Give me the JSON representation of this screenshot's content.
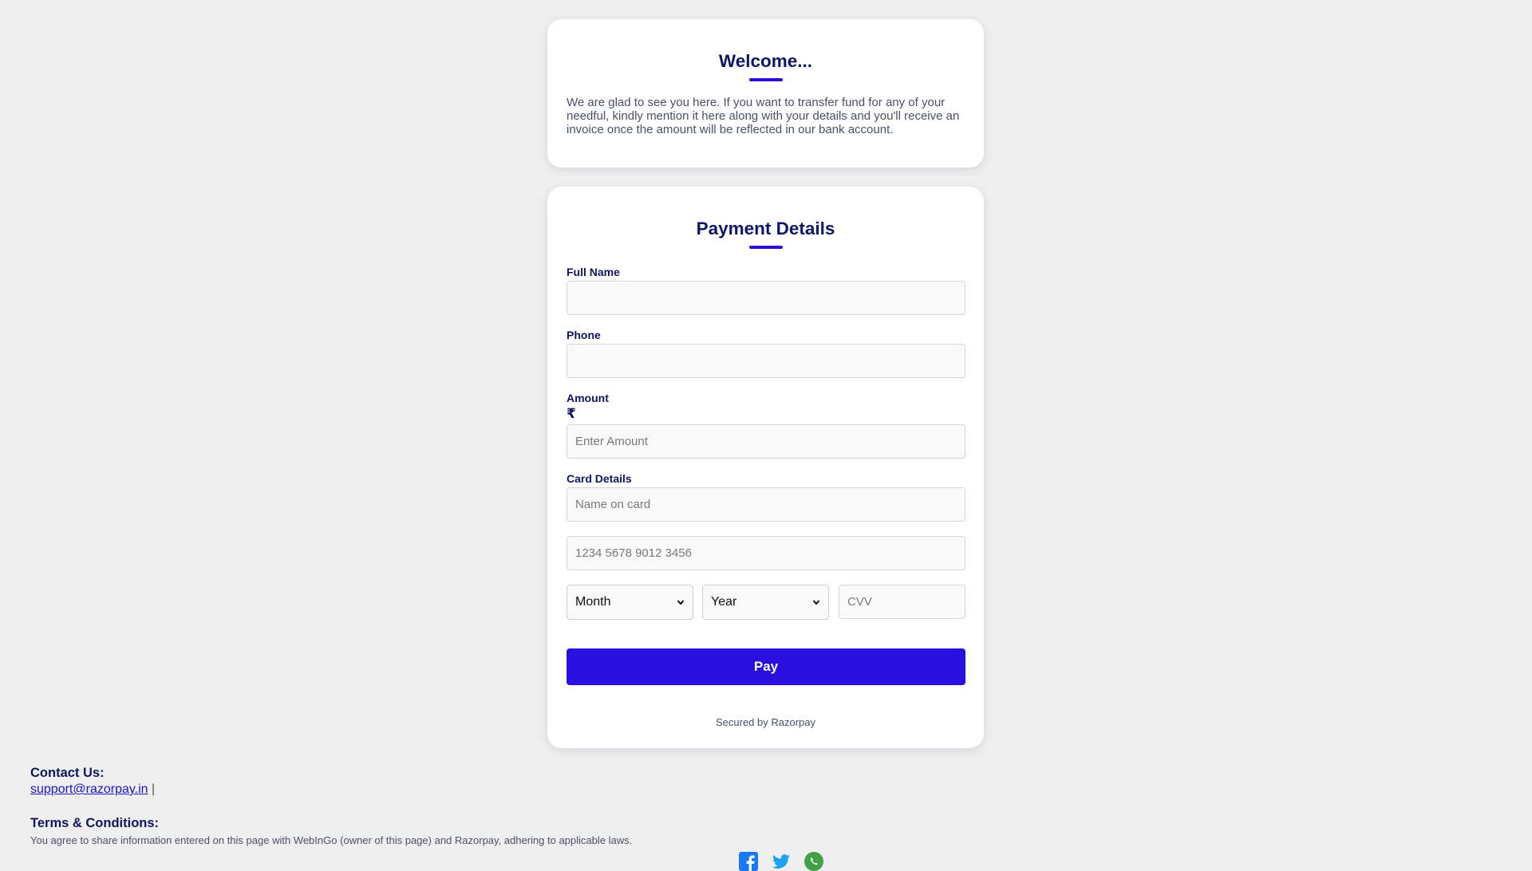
{
  "welcome": {
    "title": "Welcome...",
    "text": "We are glad to see you here. If you want to transfer fund for any of your needful, kindly mention it here along with your details and you'll receive an invoice once the amount will be reflected in our bank account."
  },
  "payment": {
    "title": "Payment Details",
    "full_name_label": "Full Name",
    "full_name_value": "",
    "phone_label": "Phone",
    "phone_value": "",
    "amount_label": "Amount",
    "currency_symbol": "₹",
    "amount_placeholder": "Enter Amount",
    "card_details_label": "Card Details",
    "name_on_card_placeholder": "Name on card",
    "card_number_placeholder": "1234 5678 9012 3456",
    "month_selected": "Month",
    "year_selected": "Year",
    "cvv_placeholder": "CVV",
    "pay_label": "Pay",
    "secured_text": "Secured by Razorpay"
  },
  "footer": {
    "contact_heading": "Contact Us:",
    "contact_email": "support@razorpay.in",
    "separator": "|",
    "terms_heading": "Terms & Conditions:",
    "terms_text": "You agree to share information entered on this page with WebInGo (owner of this page) and Razorpay, adhering to applicable laws."
  },
  "social_icons": [
    "facebook-icon",
    "twitter-icon",
    "whatsapp-icon"
  ],
  "colors": {
    "accent": "#2a10de",
    "heading": "#101563",
    "background": "#efefef"
  }
}
